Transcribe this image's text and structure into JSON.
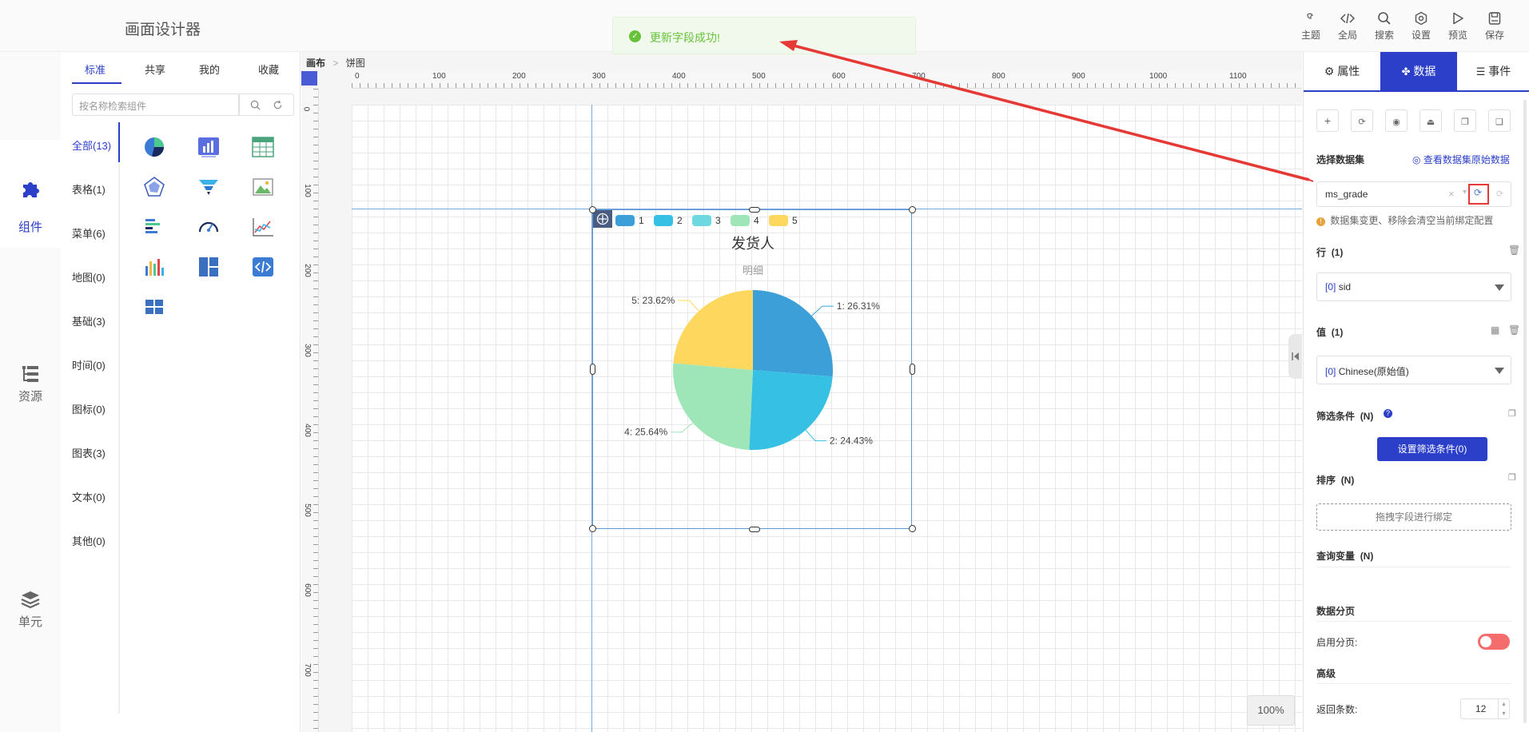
{
  "app": {
    "title": "画面设计器"
  },
  "toolbar": {
    "items": [
      {
        "label": "主题",
        "icon": "theme-icon"
      },
      {
        "label": "全局",
        "icon": "code-icon"
      },
      {
        "label": "搜索",
        "icon": "search-icon"
      },
      {
        "label": "设置",
        "icon": "gear-icon"
      },
      {
        "label": "预览",
        "icon": "play-icon"
      },
      {
        "label": "保存",
        "icon": "save-icon"
      }
    ]
  },
  "toast": {
    "message": "更新字段成功!",
    "color": "#67c23a"
  },
  "leftnav": {
    "items": [
      {
        "label": "组件",
        "icon": "puzzle-icon"
      },
      {
        "label": "资源",
        "icon": "list-tree-icon"
      },
      {
        "label": "单元",
        "icon": "layers-icon"
      }
    ]
  },
  "component_panel": {
    "tabs": [
      "标准",
      "共享",
      "我的",
      "收藏"
    ],
    "search_placeholder": "按名称检索组件",
    "categories": [
      "全部(13)",
      "表格(1)",
      "菜单(6)",
      "地图(0)",
      "基础(3)",
      "时间(0)",
      "图标(0)",
      "图表(3)",
      "文本(0)",
      "其他(0)"
    ],
    "icons": [
      "pie-chart-icon",
      "bar-chart-icon",
      "table-icon",
      "radar-chart-icon",
      "funnel-chart-icon",
      "image-icon",
      "horizontal-bar-icon",
      "gauge-icon",
      "line-chart-icon",
      "column-chart-icon",
      "layout-grid-icon",
      "code-embed-icon",
      "dashboard-layout-icon"
    ]
  },
  "canvas": {
    "breadcrumb": [
      "画布",
      "饼图"
    ],
    "ruler_h": [
      "0",
      "100",
      "200",
      "300",
      "400",
      "500",
      "600",
      "700",
      "800",
      "900",
      "1000",
      "1100"
    ],
    "ruler_v": [
      "0",
      "100",
      "200",
      "300",
      "400",
      "500",
      "600",
      "700"
    ],
    "zoom": "100%"
  },
  "chart_data": {
    "type": "pie",
    "title": "发货人",
    "subtitle": "明细",
    "categories": [
      "1",
      "2",
      "3",
      "4",
      "5"
    ],
    "values": [
      26.31,
      24.43,
      0,
      25.64,
      23.62
    ],
    "labels": [
      "1: 26.31%",
      "2: 24.43%",
      "",
      "4: 25.64%",
      "5: 23.62%"
    ],
    "colors": [
      "#3c9fd8",
      "#36c1e4",
      "#6dd8e0",
      "#9ee6b8",
      "#fdd75e"
    ],
    "legend_position": "top-left"
  },
  "right_panel": {
    "tabs": [
      "属性",
      "数据",
      "事件"
    ],
    "dataset_label": "选择数据集",
    "view_raw_link": "查看数据集原始数据",
    "dataset_value": "ms_grade",
    "warning": "数据集变更、移除会清空当前绑定配置",
    "row_label": "行",
    "row_count": "(1)",
    "row_value_idx": "[0]",
    "row_value": "sid",
    "value_label": "值",
    "value_count": "(1)",
    "value_idx": "[0]",
    "value_value": "Chinese(原始值)",
    "filter_label": "筛选条件",
    "filter_count": "(N)",
    "filter_button": "设置筛选条件(0)",
    "sort_label": "排序",
    "sort_count": "(N)",
    "drag_hint": "拖拽字段进行绑定",
    "query_var_label": "查询变量",
    "query_var_count": "(N)",
    "paging_label": "数据分页",
    "enable_paging_label": "启用分页:",
    "advanced_label": "高级",
    "return_count_label": "返回条数:",
    "return_count_value": "12"
  }
}
